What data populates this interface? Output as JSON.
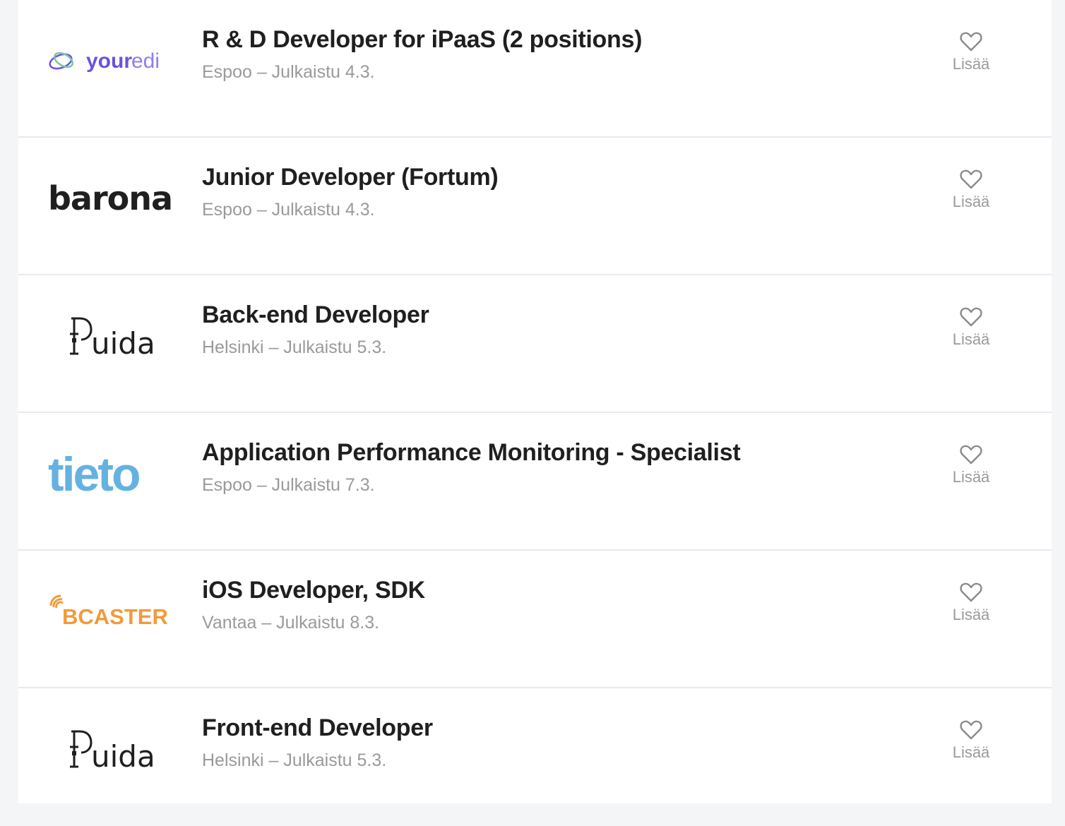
{
  "accent": "#6b52e0",
  "jobs": [
    {
      "title": "R & D Developer for iPaaS (2 positions)",
      "meta": "Espoo – Julkaistu 4.3.",
      "logo": {
        "icon": "youredi-logo",
        "word1": "your",
        "word2": "edi"
      },
      "fav_label": "Lisää"
    },
    {
      "title": "Junior Developer (Fortum)",
      "meta": "Espoo – Julkaistu 4.3.",
      "logo": {
        "icon": "barona-logo",
        "word1": "barona"
      },
      "fav_label": "Lisää"
    },
    {
      "title": "Back-end Developer",
      "meta": "Helsinki – Julkaistu 5.3.",
      "logo": {
        "icon": "puida-logo",
        "word1": "uida"
      },
      "fav_label": "Lisää"
    },
    {
      "title": "Application Performance Monitoring - Specialist",
      "meta": "Espoo – Julkaistu 7.3.",
      "logo": {
        "icon": "tieto-logo",
        "word1": "tieto"
      },
      "fav_label": "Lisää"
    },
    {
      "title": "iOS Developer, SDK",
      "meta": "Vantaa – Julkaistu 8.3.",
      "logo": {
        "icon": "bcaster-logo",
        "word1": "BCASTER"
      },
      "fav_label": "Lisää"
    },
    {
      "title": "Front-end Developer",
      "meta": "Helsinki – Julkaistu 5.3.",
      "logo": {
        "icon": "puida-logo",
        "word1": "uida"
      },
      "fav_label": "Lisää"
    }
  ]
}
